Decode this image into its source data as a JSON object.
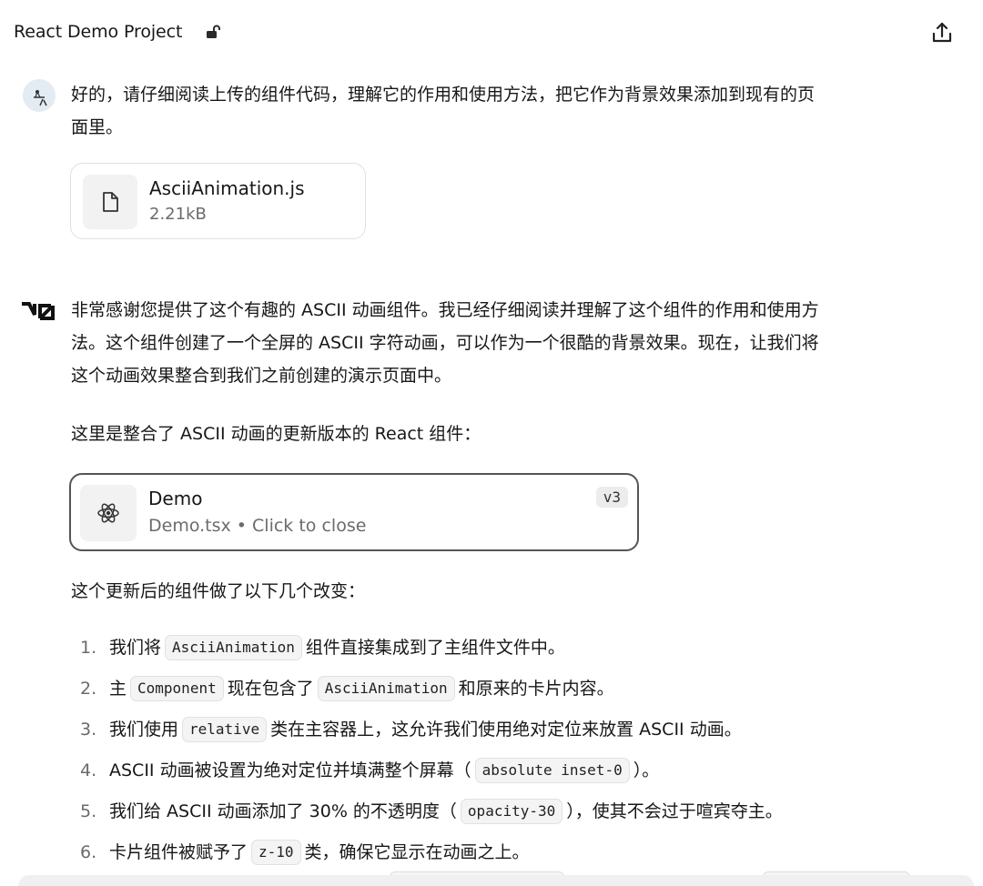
{
  "header": {
    "title": "React Demo Project",
    "lock_icon": "unlocked-icon",
    "share_icon": "share-icon"
  },
  "user_message": {
    "avatar": "user-avatar",
    "text_line1": "好的，请仔细阅读上传的组件代码，理解它的作用和使用方法，把它作为背景效果添加到现有的页",
    "text_line2": "面里。",
    "attachment": {
      "icon": "file-icon",
      "name": "AsciiAnimation.js",
      "size": "2.21kB"
    }
  },
  "assistant_message": {
    "logo": "v0-logo",
    "para1_line1": "非常感谢您提供了这个有趣的 ASCII 动画组件。我已经仔细阅读并理解了这个组件的作用和使用方",
    "para1_line2": "法。这个组件创建了一个全屏的 ASCII 字符动画，可以作为一个很酷的背景效果。现在，让我们将",
    "para1_line3": "这个动画效果整合到我们之前创建的演示页面中。",
    "para2": "这里是整合了 ASCII 动画的更新版本的 React 组件：",
    "demo_card": {
      "icon": "react-icon",
      "title": "Demo",
      "subtitle": "Demo.tsx • Click to close",
      "version": "v3"
    },
    "changes_intro": "这个更新后的组件做了以下几个改变：",
    "changes": [
      {
        "num": "1.",
        "pre": "我们将",
        "code": "AsciiAnimation",
        "post": "组件直接集成到了主组件文件中。"
      },
      {
        "num": "2.",
        "pre": "主",
        "code": "Component",
        "mid": "现在包含了",
        "code2": "AsciiAnimation",
        "post": "和原来的卡片内容。"
      },
      {
        "num": "3.",
        "pre": "我们使用",
        "code": "relative",
        "post": "类在主容器上，这允许我们使用绝对定位来放置 ASCII 动画。"
      },
      {
        "num": "4.",
        "pre": "ASCII 动画被设置为绝对定位并填满整个屏幕（",
        "code": "absolute inset-0",
        "post": "）。"
      },
      {
        "num": "5.",
        "pre": "我们给 ASCII 动画添加了 30% 的不透明度（",
        "code": "opacity-30",
        "post": "），使其不会过于喧宾夺主。"
      },
      {
        "num": "6.",
        "pre": "卡片组件被赋予了",
        "code": "z-10",
        "post": "类，确保它显示在动画之上。"
      }
    ]
  }
}
